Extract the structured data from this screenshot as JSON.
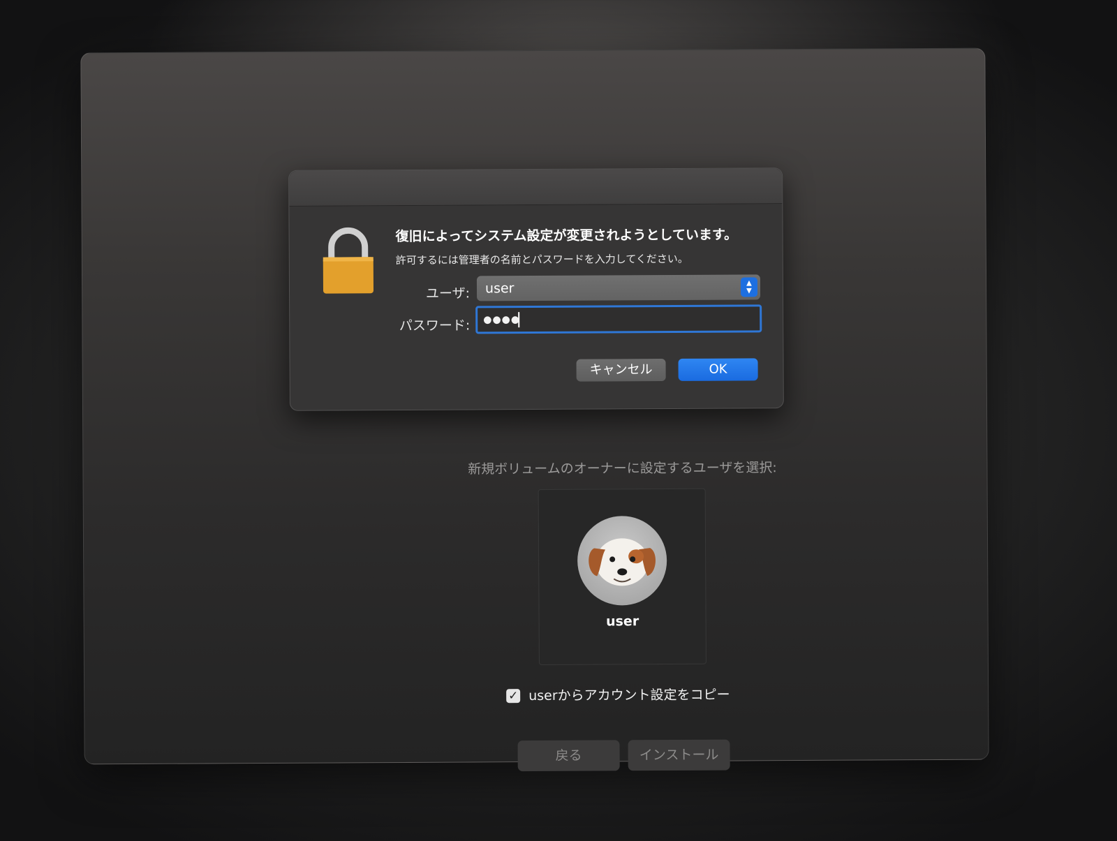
{
  "auth_dialog": {
    "title": "復旧によってシステム設定が変更されようとしています。",
    "message": "許可するには管理者の名前とパスワードを入力してください。",
    "user_label": "ユーザ:",
    "user_value": "user",
    "password_label": "パスワード:",
    "password_value": "●●●●",
    "cancel_label": "キャンセル",
    "ok_label": "OK"
  },
  "installer": {
    "owner_prompt": "新規ボリュームのオーナーに設定するユーザを選択:",
    "selected_user": "user",
    "copy_settings_label": "userからアカウント設定をコピー",
    "copy_settings_checked": true,
    "checkbox_mark": "✓",
    "back_label": "戻る",
    "install_label": "インストール"
  },
  "icons": {
    "lock": "lock-icon",
    "avatar": "dog-memoji-avatar",
    "stepper": "select-stepper-icon"
  },
  "colors": {
    "accent_blue": "#1a6be0",
    "lock_body": "#e3a02c",
    "background": "#242424"
  }
}
